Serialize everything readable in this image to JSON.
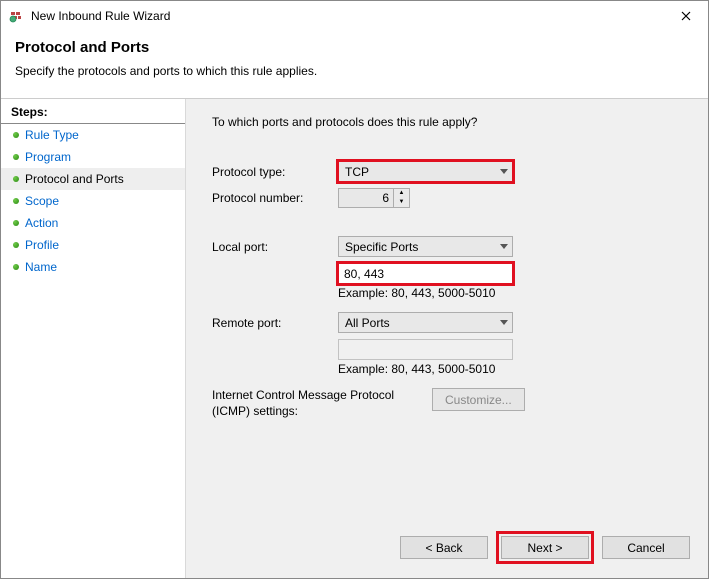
{
  "window": {
    "title": "New Inbound Rule Wizard"
  },
  "header": {
    "title": "Protocol and Ports",
    "subtitle": "Specify the protocols and ports to which this rule applies."
  },
  "steps": {
    "header": "Steps:",
    "items": [
      {
        "label": "Rule Type",
        "current": false
      },
      {
        "label": "Program",
        "current": false
      },
      {
        "label": "Protocol and Ports",
        "current": true
      },
      {
        "label": "Scope",
        "current": false
      },
      {
        "label": "Action",
        "current": false
      },
      {
        "label": "Profile",
        "current": false
      },
      {
        "label": "Name",
        "current": false
      }
    ]
  },
  "content": {
    "prompt": "To which ports and protocols does this rule apply?",
    "protocol_type_label": "Protocol type:",
    "protocol_type_value": "TCP",
    "protocol_number_label": "Protocol number:",
    "protocol_number_value": "6",
    "local_port_label": "Local port:",
    "local_port_select": "Specific Ports",
    "local_port_value": "80, 443",
    "local_port_example": "Example: 80, 443, 5000-5010",
    "remote_port_label": "Remote port:",
    "remote_port_select": "All Ports",
    "remote_port_value": "",
    "remote_port_example": "Example: 80, 443, 5000-5010",
    "icmp_label": "Internet Control Message Protocol (ICMP) settings:",
    "customize_label": "Customize..."
  },
  "buttons": {
    "back": "< Back",
    "next": "Next >",
    "cancel": "Cancel"
  }
}
